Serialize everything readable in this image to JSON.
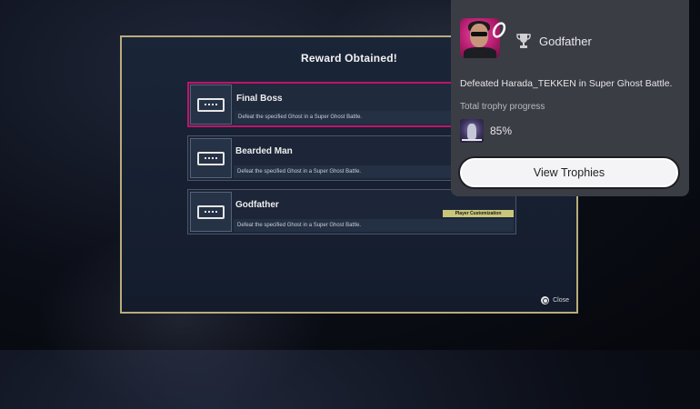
{
  "panel": {
    "title": "Reward Obtained!",
    "rewards": [
      {
        "name": "Final Boss",
        "description": "Defeat the specified Ghost in a Super Ghost Battle.",
        "tag": "",
        "selected": true
      },
      {
        "name": "Bearded Man",
        "description": "Defeat the specified Ghost in a Super Ghost Battle.",
        "tag": "",
        "selected": false
      },
      {
        "name": "Godfather",
        "description": "Defeat the specified Ghost in a Super Ghost Battle.",
        "tag": "Player Customization",
        "selected": false
      }
    ],
    "close_label": "Close"
  },
  "trophy_toast": {
    "trophy_name": "Godfather",
    "description": "Defeated Harada_TEKKEN in Super Ghost Battle.",
    "progress_label": "Total trophy progress",
    "progress_value": "85%",
    "view_button_label": "View Trophies"
  },
  "colors": {
    "panel_border": "#b9ac7c",
    "selected_border": "#c0136a",
    "tag_background": "#c9c57a",
    "toast_background": "#3b3d45"
  },
  "icons": [
    "nameplate-icon",
    "circle-button-icon",
    "trophy-icon",
    "avatar-badge-icon"
  ]
}
